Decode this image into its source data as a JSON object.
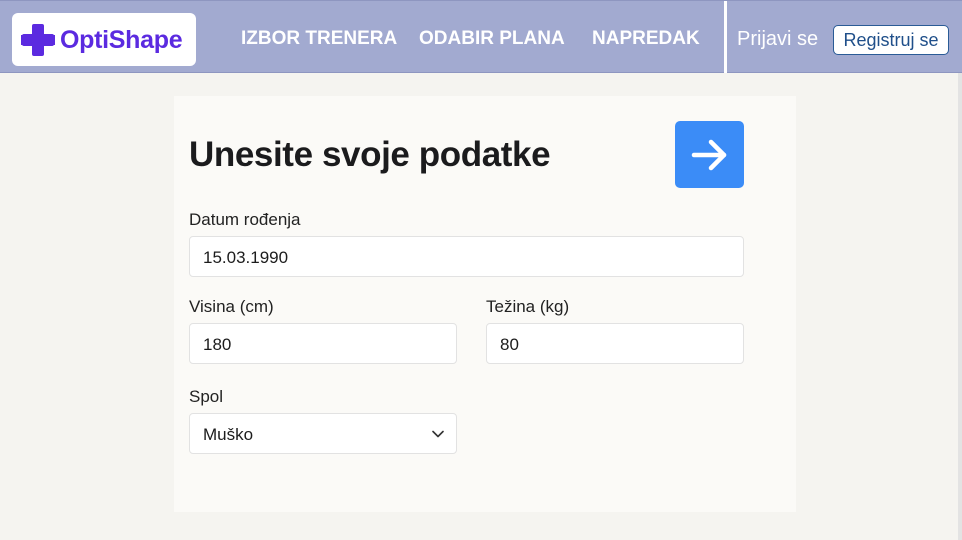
{
  "header": {
    "brand": "OptiShape",
    "nav": [
      "IZBOR TRENERA",
      "ODABIR PLANA",
      "NAPREDAK"
    ],
    "login": "Prijavi se",
    "register": "Registruj se"
  },
  "form": {
    "title": "Unesite svoje podatke",
    "birthdate": {
      "label": "Datum rođenja",
      "value": "15.03.1990"
    },
    "height": {
      "label": "Visina (cm)",
      "value": "180"
    },
    "weight": {
      "label": "Težina (kg)",
      "value": "80"
    },
    "gender": {
      "label": "Spol",
      "value": "Muško"
    }
  },
  "colors": {
    "navbar": "#a2aad0",
    "brand": "#5b2ae0",
    "accent_button": "#3b8cf7",
    "register_border": "#2a5b96"
  },
  "icons": {
    "logo": "plus-icon",
    "next": "arrow-right-icon",
    "select": "chevron-down-icon"
  }
}
